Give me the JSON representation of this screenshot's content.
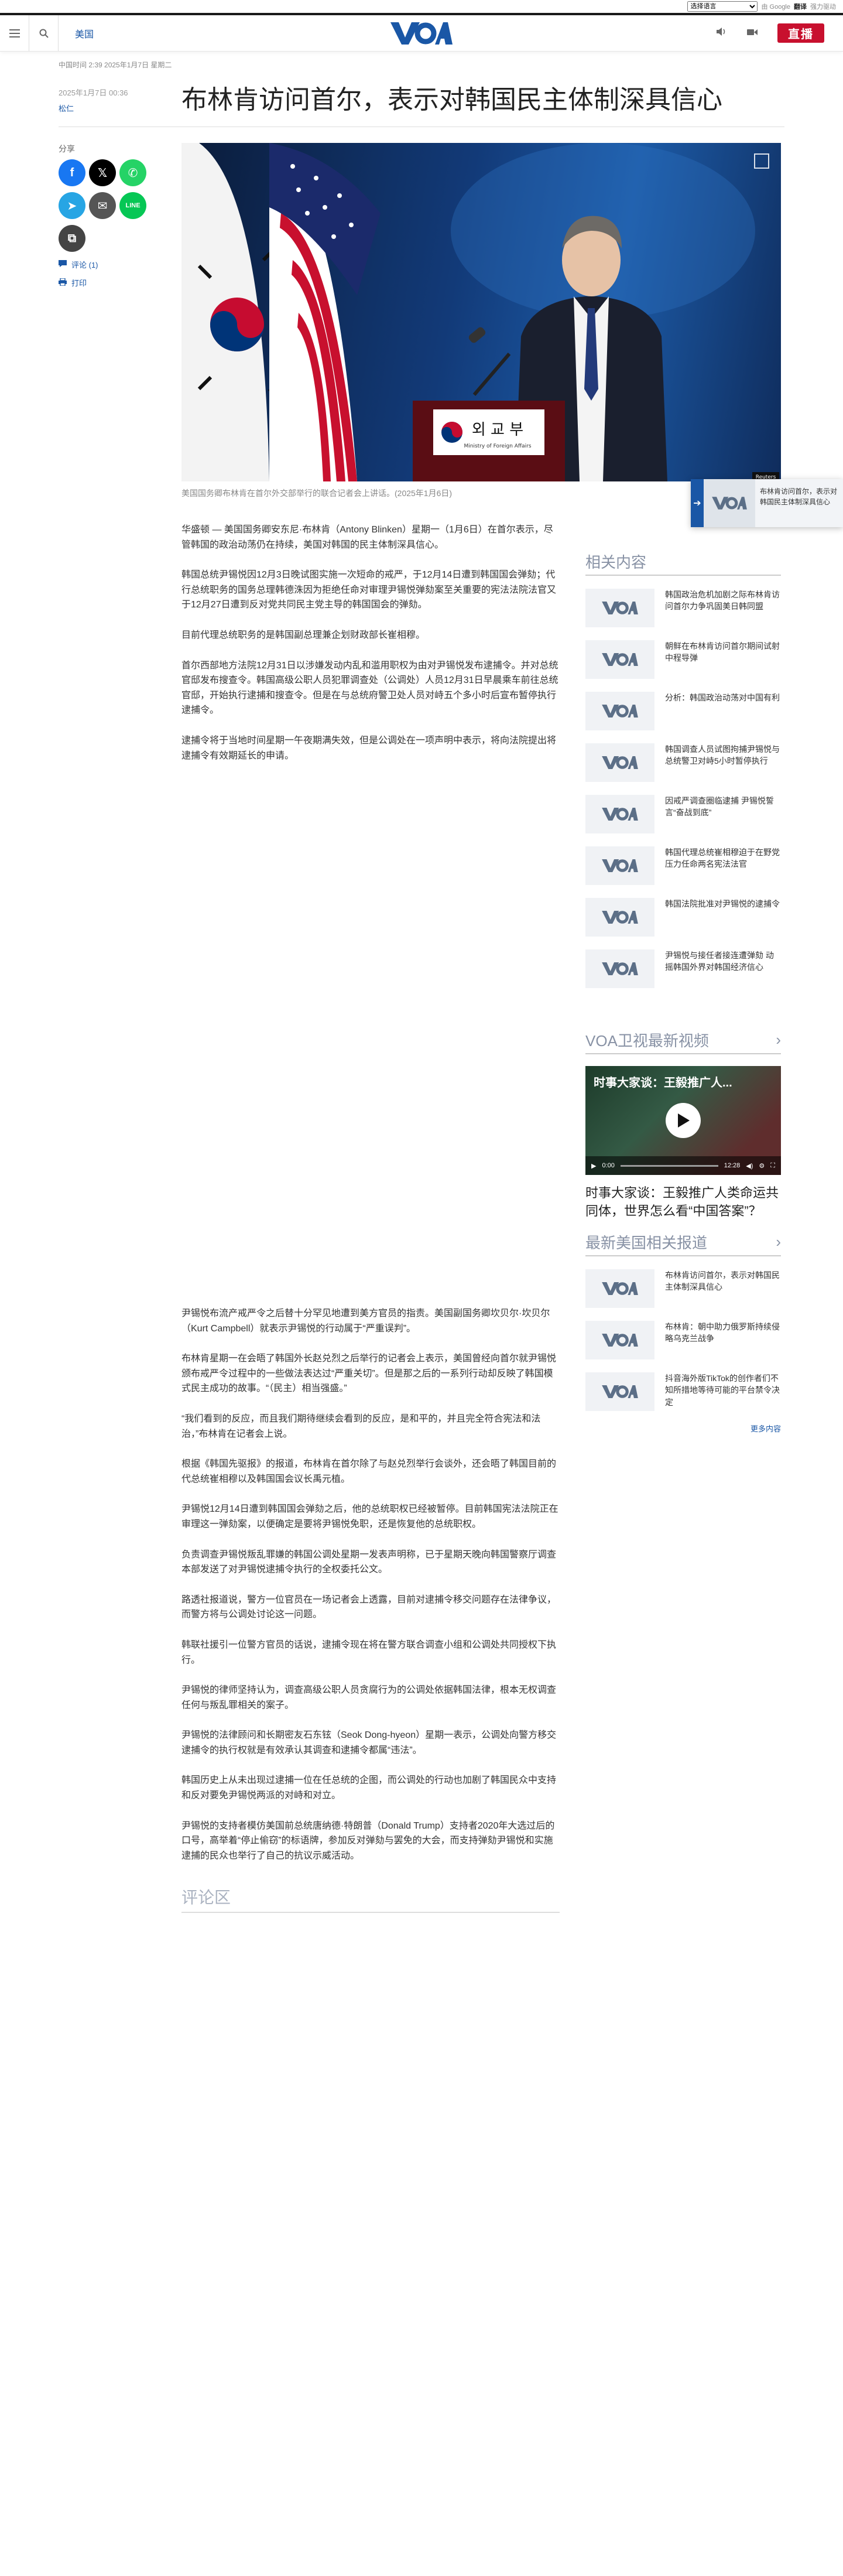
{
  "translate": {
    "select_label": "选择语言",
    "powered": "由 Google",
    "brand": "翻译",
    "suffix": "强力驱动"
  },
  "header": {
    "section": "美国",
    "live": "直播"
  },
  "article": {
    "dateline": "中国时间 2:39 2025年1月7日 星期二",
    "date": "2025年1月7日 00:36",
    "author": "松仁",
    "title": "布林肯访问首尔，表示对韩国民主体制深具信心",
    "share_label": "分享",
    "comments_link": "评论 (1)",
    "print_link": "打印",
    "caption": "美国国务卿布林肯在首尔外交部举行的联合记者会上讲话。(2025年1月6日)",
    "paragraphs_top": [
      "华盛顿 — 美国国务卿安东尼·布林肯（Antony Blinken）星期一（1月6日）在首尔表示，尽管韩国的政治动荡仍在持续，美国对韩国的民主体制深具信心。",
      "韩国总统尹锡悦因12月3日晚试图实施一次短命的戒严，于12月14日遭到韩国国会弹劾；代行总统职务的国务总理韩德洙因为拒绝任命对审理尹锡悦弹劾案至关重要的宪法法院法官又于12月27日遭到反对党共同民主党主导的韩国国会的弹劾。",
      "目前代理总统职务的是韩国副总理兼企划财政部长崔相穆。",
      "首尔西部地方法院12月31日以涉嫌发动内乱和滥用职权为由对尹锡悦发布逮捕令。并对总统官邸发布搜查令。韩国高级公职人员犯罪调查处（公调处）人员12月31日早晨乘车前往总统官邸，开始执行逮捕和搜查令。但是在与总统府警卫处人员对峙五个多小时后宣布暂停执行逮捕令。",
      "逮捕令将于当地时间星期一午夜期满失效，但是公调处在一项声明中表示，将向法院提出将逮捕令有效期延长的申请。"
    ],
    "paragraphs_bottom": [
      "尹锡悦布流产戒严令之后替十分罕见地遭到美方官员的指责。美国副国务卿坎贝尔·坎贝尔（Kurt Campbell）就表示尹锡悦的行动属于“严重误判”。",
      "布林肯星期一在会晤了韩国外长赵兑烈之后举行的记者会上表示，美国曾经向首尔就尹锡悦颁布戒严令过程中的一些做法表达过“严重关切”。但是那之后的一系列行动却反映了韩国模式民主成功的故事。“（民主）相当强盛。”",
      "“我们看到的反应，而且我们期待继续会看到的反应，是和平的，并且完全符合宪法和法治，”布林肯在记者会上说。",
      "根据《韩国先驱报》的报道，布林肯在首尔除了与赵兑烈举行会谈外，还会晤了韩国目前的代总统崔相穆以及韩国国会议长禹元植。",
      "尹锡悦12月14日遭到韩国国会弹劾之后，他的总统职权已经被暂停。目前韩国宪法法院正在审理这一弹劾案，以便确定是要将尹锡悦免职，还是恢复他的总统职权。",
      "负责调查尹锡悦叛乱罪嫌的韩国公调处星期一发表声明称，已于星期天晚向韩国警察厅调查本部发送了对尹锡悦逮捕令执行的全权委托公文。",
      "路透社报道说，警方一位官员在一场记者会上透露，目前对逮捕令移交问题存在法律争议，而警方将与公调处讨论这一问题。",
      "韩联社援引一位警方官员的话说，逮捕令现在将在警方联合调查小组和公调处共同授权下执行。",
      "尹锡悦的律师坚持认为，调查高级公职人员贪腐行为的公调处依据韩国法律，根本无权调查任何与叛乱罪相关的案子。",
      "尹锡悦的法律顾问和长期密友石东铉（Seok Dong-hyeon）星期一表示，公调处向警方移交逮捕令的执行权就是有效承认其调查和逮捕令都属“违法”。",
      "韩国历史上从未出现过逮捕一位在任总统的企图，而公调处的行动也加剧了韩国民众中支持和反对要免尹锡悦两派的对峙和对立。",
      "尹锡悦的支持者模仿美国前总统唐纳德·特朗普（Donald Trump）支持者2020年大选过后的口号，高举着“停止偷窃”的标语牌，参加反对弹劾与罢免的大会，而支持弹劾尹锡悦和实施逮捕的民众也举行了自己的抗议示威活动。"
    ],
    "comments_heading": "评论区"
  },
  "image_sign": {
    "korean": "외 교 부",
    "english": "Ministry of Foreign Affairs",
    "credit": "Reuters"
  },
  "rail": {
    "related_heading": "相关内容",
    "related": [
      "韩国政治危机加剧之际布林肯访问首尔力争巩固美日韩同盟",
      "朝鲜在布林肯访问首尔期间试射中程导弹",
      "分析：韩国政治动荡对中国有利",
      "韩国调查人员试图拘捕尹锡悦与总统警卫对峙5小时暂停执行",
      "因戒严调查圈临逮捕 尹锡悦誓言“奋战到底”",
      "韩国代理总统崔相穆迫于在野党压力任命两名宪法法官",
      "韩国法院批准对尹锡悦的逮捕令",
      "尹锡悦与接任者接连遭弹劾 动摇韩国外界对韩国经济信心"
    ],
    "video_heading": "VOA卫视最新视频",
    "video_overlay": "时事大家谈：王毅推广人...",
    "video_time": "0:00",
    "video_duration": "12:28",
    "video_caption": "时事大家谈：王毅推广人类命运共同体，世界怎么看“中国答案”？",
    "latest_heading": "最新美国相关报道",
    "latest": [
      "布林肯访问首尔，表示对韩国民主体制深具信心",
      "布林肯：朝中助力俄罗斯持续侵略乌克兰战争",
      "抖音海外版TikTok的创作者们不知所措地等待可能的平台禁令决定"
    ],
    "more": "更多内容"
  },
  "floating": {
    "text": "布林肯访问首尔，表示对韩国民主体制深具信心"
  }
}
